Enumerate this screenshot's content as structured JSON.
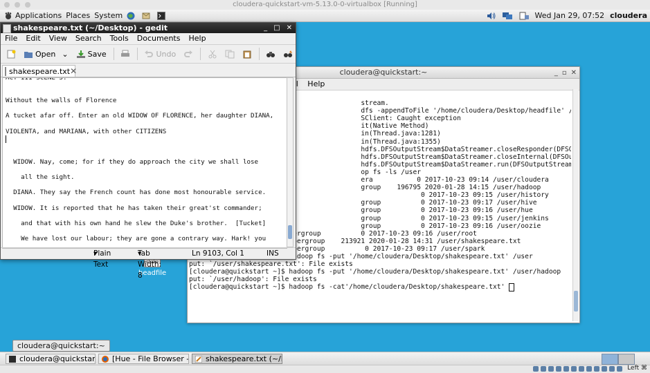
{
  "vbox": {
    "title": "cloudera-quickstart-vm-5.13.0-0-virtualbox [Running]",
    "host_key": "Left ⌘"
  },
  "top_panel": {
    "applications": "Applications",
    "places": "Places",
    "system": "System",
    "clock": "Wed Jan 29, 07:52",
    "user": "cloudera"
  },
  "gedit": {
    "title": "shakespeare.txt (~/Desktop) - gedit",
    "menu": [
      "File",
      "Edit",
      "View",
      "Search",
      "Tools",
      "Documents",
      "Help"
    ],
    "toolbar": {
      "open": "Open",
      "save": "Save",
      "undo": "Undo"
    },
    "tab_label": "shakespeare.txt",
    "lines": [
      "ACT III SCENE 5.",
      "",
      "",
      "Without the walls of Florence",
      "",
      "A tucket afar off. Enter an old WIDOW OF FLORENCE, her daughter DIANA,",
      "",
      "VIOLENTA, and MARIANA, with other CITIZENS",
      "",
      "",
      "",
      "  WIDOW. Nay, come; for if they do approach the city we shall lose",
      "",
      "    all the sight.",
      "",
      "  DIANA. They say the French count has done most honourable service.",
      "",
      "  WIDOW. It is reported that he has taken their great'st commander;",
      "",
      "    and that with his own hand he slew the Duke's brother.  [Tucket]",
      "",
      "    We have lost our labour; they are gone a contrary way. Hark! you"
    ],
    "status": {
      "lang": "Plain Text",
      "tab_width": "Tab Width:  8",
      "position": "Ln 9103, Col 1",
      "mode": "INS"
    }
  },
  "terminal": {
    "title": "cloudera@quickstart:~",
    "menu": [
      "al",
      "Help"
    ],
    "lines": [
      "",
      "                                                              ",
      "                                           stream.",
      "",
      "                                           dfs -appendToFile '/home/cloudera/Desktop/headfile' /user/shakespeare.txt",
      "                                           SClient: Caught exception",
      "",
      "                                           it(Native Method)",
      "                                           in(Thread.java:1281)",
      "                                           in(Thread.java:1355)",
      "                                           hdfs.DFSOutputStream$DataStreamer.closeResponder(DFSOutputStream.java:967)",
      "                                           hdfs.DFSOutputStream$DataStreamer.closeInternal(DFSOutputStream.java:935)",
      "                                           hdfs.DFSOutputStream$DataStreamer.run(DFSOutputStream.java:931)",
      "                                           op fs -ls /user",
      "",
      "                                           era           0 2017-10-23 09:14 /user/cloudera",
      "                                           group    196795 2020-01-28 14:15 /user/hadoop",
      "                                                          0 2017-10-23 09:15 /user/history",
      "                                           group          0 2017-10-23 09:17 /user/hive",
      "                                           group          0 2017-10-23 09:16 /user/hue",
      "                                           group          0 2017-10-23 09:15 /user/jenkins",
      "                                           group          0 2017-10-23 09:16 /user/oozie",
      "drwxrwxrwx   - root    supergroup          0 2017-10-23 09:16 /user/root",
      "-rw-r--r--   1 cloudera supergroup    213921 2020-01-28 14:31 /user/shakespeare.txt",
      "drwxr-xr-x   - hdfs     supergroup          0 2017-10-23 09:17 /user/spark",
      "[cloudera@quickstart ~]$ hadoop fs -put '/home/cloudera/Desktop/shakespeare.txt' /user",
      "put: `/user/shakespeare.txt': File exists",
      "[cloudera@quickstart ~]$ hadoop fs -put '/home/cloudera/Desktop/shakespeare.txt' /user/hadoop",
      "put: `/user/hadoop': File exists",
      "[cloudera@quickstart ~]$ hadoop fs -cat'/home/cloudera/Desktop/shakespeare.txt' "
    ]
  },
  "desktop": {
    "file_label": "headfile",
    "file_thumb": "shake",
    "task_tooltip": "cloudera@quickstart:~"
  },
  "taskbar": {
    "items": [
      "cloudera@quickstart:~",
      "[Hue - File Browser - M...",
      "shakespeare.txt (~/De..."
    ]
  }
}
